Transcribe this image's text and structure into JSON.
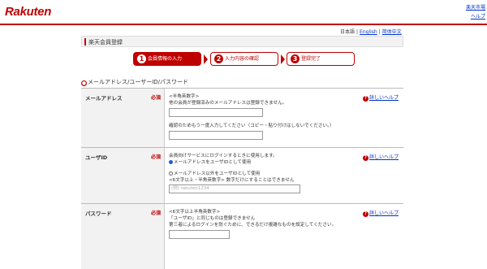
{
  "header": {
    "logo": "Rakuten",
    "links": [
      "楽天市場",
      "ヘルプ"
    ]
  },
  "lang": {
    "current": "日本語",
    "english": "English",
    "chinese": "简体中文"
  },
  "page_title": "楽天会員登録",
  "steps": [
    {
      "num": "1",
      "label": "会員情報の入力"
    },
    {
      "num": "2",
      "label": "入力内容の確認"
    },
    {
      "num": "3",
      "label": "登録完了"
    }
  ],
  "section_title": "メールアドレス/ユーザーID/パスワード",
  "help_label": "詳しいヘルプ",
  "required_label": "必須",
  "email": {
    "label": "メールアドレス",
    "hint": "<半角英数字>",
    "note": "他の会員が登録済みのメールアドレスは登録できません。",
    "confirm_note": "確認のためもう一度入力してください（コピー・貼り付けはしないでください。）"
  },
  "userid": {
    "label": "ユーザID",
    "note": "会員向けサービスにログインするときに使用します。",
    "option1": "メールアドレスをユーザIDとして使用",
    "option2": "メールアドレス以外をユーザIDとして使用",
    "hint": "<6文字以上・半角英数字> 数字だけにすることはできません",
    "placeholder": "(例) rakuten1234"
  },
  "password": {
    "label": "パスワード",
    "hint": "<6文字以上半角英数字>",
    "note1": "「ユーザID」と同じものは登録できません",
    "note2": "第三者によるログインを防ぐために、できるだけ複雑なものを設定してください。"
  }
}
